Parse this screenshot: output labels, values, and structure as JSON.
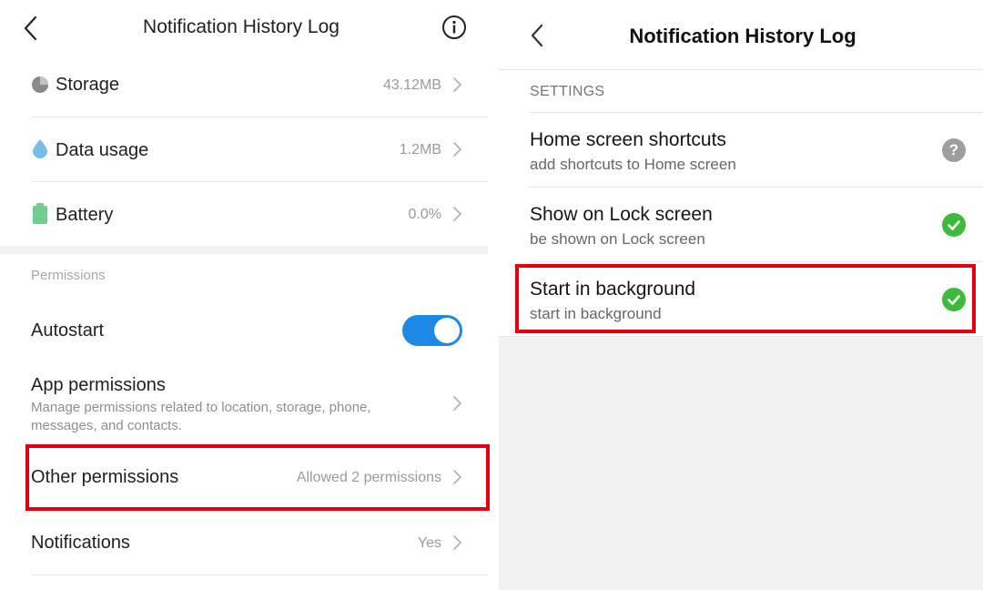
{
  "left": {
    "header": {
      "title": "Notification History Log",
      "back_icon": "chevron-left-icon",
      "info_icon": "info-icon"
    },
    "usage_rows": [
      {
        "label": "Storage",
        "value": "43.12MB",
        "icon": "pie-chart-icon"
      },
      {
        "label": "Data usage",
        "value": "1.2MB",
        "icon": "water-drop-icon"
      },
      {
        "label": "Battery",
        "value": "0.0%",
        "icon": "battery-icon"
      }
    ],
    "permissions_section": "Permissions",
    "autostart": {
      "label": "Autostart",
      "enabled": true
    },
    "app_permissions": {
      "label": "App permissions",
      "description": "Manage permissions related to location, storage, phone, messages, and contacts."
    },
    "other_permissions": {
      "label": "Other permissions",
      "value": "Allowed 2 permissions",
      "highlighted": true
    },
    "notifications": {
      "label": "Notifications",
      "value": "Yes"
    }
  },
  "right": {
    "header": {
      "title": "Notification History Log",
      "back_icon": "chevron-left-icon"
    },
    "section": "SETTINGS",
    "items": [
      {
        "label": "Home screen shortcuts",
        "sublabel": "add shortcuts to Home screen",
        "state": "unknown",
        "icon": "help-circle-icon"
      },
      {
        "label": "Show on Lock screen",
        "sublabel": "be shown on Lock screen",
        "state": "allowed",
        "icon": "check-circle-icon"
      },
      {
        "label": "Start in background",
        "sublabel": "start in background",
        "state": "allowed",
        "icon": "check-circle-icon",
        "highlighted": true
      }
    ]
  },
  "colors": {
    "accent_blue": "#1e88e5",
    "highlight_red": "#e4000f",
    "check_green": "#3cba3c",
    "help_gray": "#9e9e9e"
  }
}
